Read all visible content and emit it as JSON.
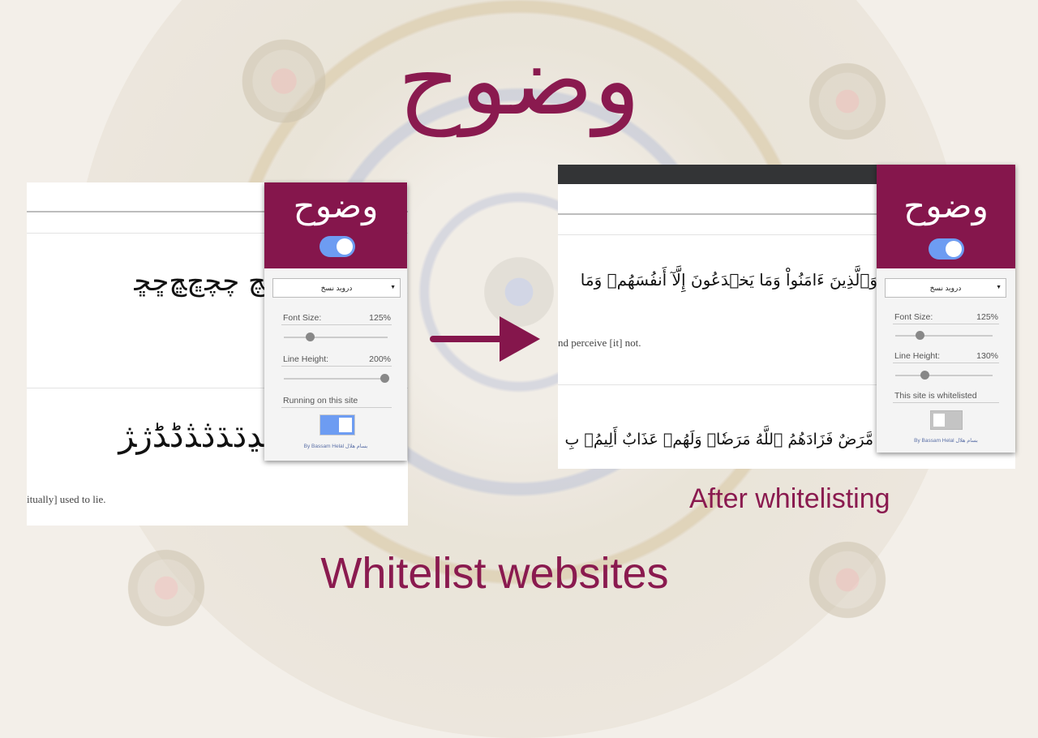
{
  "header": {
    "title": "وضوح"
  },
  "captions": {
    "main": "Whitelist websites",
    "after": "After whitelisting"
  },
  "left_screenshot": {
    "arabic_line_1": "ﭻ ﭼﭽﭾﭿﮀﮁ",
    "arabic_line_2": "ﮂﮃﮄﮅﮆﮇﮈﮉﮊﮋ",
    "english_fragment": "itually] used to lie."
  },
  "right_screenshot": {
    "arabic_line_1": "وَٱلَّذِينَ ءَامَنُواْ وَمَا يَخۡدَعُونَ إِلَّآ أَنفُسَهُمۡ وَمَا",
    "arabic_line_2": "مَّرَضٌ فَزَادَهُمُ ٱللَّهُ مَرَضٗاۖ وَلَهُمۡ عَذَابٌ أَلِيمُۢ بِ",
    "english_fragment": "nd perceive [it] not."
  },
  "popup_left": {
    "title": "وضوح",
    "font_select": "دروید نسخ",
    "font_size_label": "Font Size:",
    "font_size_value": "125%",
    "font_size_level": 0.25,
    "line_height_label": "Line Height:",
    "line_height_value": "200%",
    "line_height_level": 1.0,
    "status_text": "Running on this site",
    "status_switch": "on",
    "credit": "By Bassam Helal بسام هلال"
  },
  "popup_right": {
    "title": "وضوح",
    "font_select": "دروید نسخ",
    "font_size_label": "Font Size:",
    "font_size_value": "125%",
    "font_size_level": 0.25,
    "line_height_label": "Line Height:",
    "line_height_value": "130%",
    "line_height_level": 0.3,
    "status_text": "This site is whitelisted",
    "status_switch": "off",
    "credit": "By Bassam Helal بسام هلال"
  },
  "colors": {
    "brand": "#85164c",
    "accent_blue": "#6d9cf2"
  },
  "icons": {
    "arrow": "arrow-right-icon",
    "toggle": "toggle-switch-icon"
  }
}
